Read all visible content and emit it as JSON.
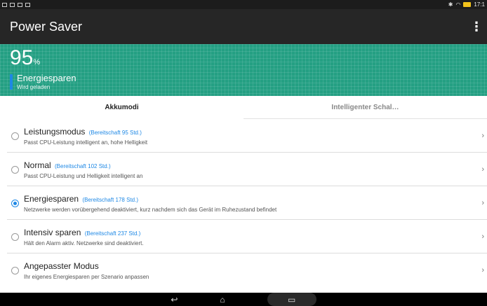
{
  "status_bar": {
    "left_icons": [
      "usb-icon",
      "message-icon",
      "image-icon",
      "lock-icon"
    ],
    "right_icons": [
      "bluetooth-icon",
      "wifi-icon",
      "battery-charging-icon"
    ],
    "time": "17:1"
  },
  "action_bar": {
    "title": "Power Saver",
    "menu_icon": "overflow-menu-icon"
  },
  "header": {
    "battery_value": "95",
    "battery_unit": "%",
    "mode_name": "Energiesparen",
    "charging_status": "Wird geladen",
    "background_color": "#249f83",
    "accent_color": "#1e88e5"
  },
  "tabs": [
    {
      "label": "Akkumodi",
      "active": true
    },
    {
      "label": "Intelligenter Schal…",
      "active": false
    }
  ],
  "modes": [
    {
      "name": "Leistungsmodus",
      "standby": "(Bereitschaft 95 Std.)",
      "desc": "Passt CPU-Leistung intelligent an, hohe Helligkeit",
      "selected": false
    },
    {
      "name": "Normal",
      "standby": "(Bereitschaft 102 Std.)",
      "desc": "Passt CPU-Leistung und Helligkeit intelligent an",
      "selected": false
    },
    {
      "name": "Energiesparen",
      "standby": "(Bereitschaft 178 Std.)",
      "desc": "Netzwerke werden vorübergehend deaktiviert, kurz nachdem sich das Gerät im Ruhezustand befindet",
      "selected": true
    },
    {
      "name": "Intensiv sparen",
      "standby": "(Bereitschaft 237 Std.)",
      "desc": "Hält den Alarm aktiv. Netzwerke sind deaktiviert.",
      "selected": false
    },
    {
      "name": "Angepasster Modus",
      "standby": "",
      "desc": "Ihr eigenes Energiesparen per Szenario anpassen",
      "selected": false
    }
  ],
  "nav_bar": {
    "icons": [
      "back-icon",
      "home-icon",
      "recent-apps-icon"
    ]
  }
}
